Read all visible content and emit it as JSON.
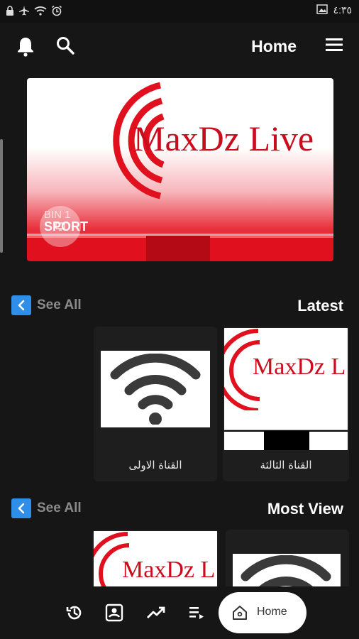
{
  "status_bar": {
    "time": "٤:٣٥",
    "icons": [
      "lock-icon",
      "airplane-icon",
      "wifi-icon",
      "alarm-icon",
      "image-icon"
    ]
  },
  "app_bar": {
    "title": "Home",
    "icons": [
      "bell-icon",
      "search-icon",
      "menu-icon"
    ]
  },
  "hero": {
    "logo_text": "MaxDz Live",
    "channel_line1": "BIN 1",
    "channel_line2": "SPORT"
  },
  "sections": [
    {
      "title": "Latest",
      "see_all": "See All",
      "cards": [
        {
          "label": "القناة الثالثة",
          "thumb": "maxdz-logo",
          "logo_text": "MaxDz L"
        },
        {
          "label": "القناة الاولى",
          "thumb": "wifi-signal"
        }
      ]
    },
    {
      "title": "Most View",
      "see_all": "See All",
      "cards": [
        {
          "label": "",
          "thumb": "wifi-signal"
        },
        {
          "label": "",
          "thumb": "maxdz-logo",
          "logo_text": "MaxDz L"
        }
      ]
    }
  ],
  "bottom_nav": {
    "items": [
      "history-icon",
      "user-box-icon",
      "trending-icon",
      "playlist-icon"
    ],
    "active_label": "Home"
  },
  "colors": {
    "brand_red": "#c80d1d",
    "accent_blue": "#2f8ee8",
    "background": "#161616"
  }
}
